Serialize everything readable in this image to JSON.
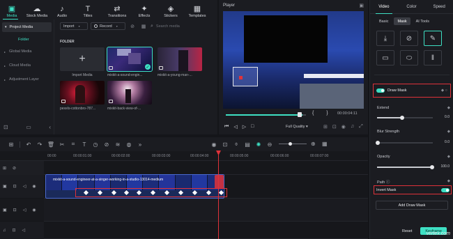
{
  "top_tools": [
    {
      "label": "Media",
      "icon": "▣",
      "active": true
    },
    {
      "label": "Stock Media",
      "icon": "☁"
    },
    {
      "label": "Audio",
      "icon": "♪"
    },
    {
      "label": "Titles",
      "icon": "T"
    },
    {
      "label": "Transitions",
      "icon": "⇄"
    },
    {
      "label": "Effects",
      "icon": "✦"
    },
    {
      "label": "Stickers",
      "icon": "◈"
    },
    {
      "label": "Templates",
      "icon": "▦"
    }
  ],
  "left_nav": {
    "project_media": "Project Media",
    "folder": "Folder",
    "items": [
      "Global Media",
      "Cloud Media",
      "Adjustment Layer"
    ]
  },
  "media_bar": {
    "import_label": "Import",
    "record_label": "Record",
    "search_placeholder": "Search media"
  },
  "folder_label": "FOLDER",
  "media_items": [
    {
      "caption": "Import Media"
    },
    {
      "caption": "mixkit-a-sound-engin..."
    },
    {
      "caption": "mixkit-a-young-man-..."
    },
    {
      "caption": "pexels-cottonbro-787..."
    },
    {
      "caption": "mixkit-back-view-of-..."
    }
  ],
  "player": {
    "title": "Player",
    "timecode": "00:00:04:11",
    "quality": "Full Quality",
    "brackets": "{ }"
  },
  "props": {
    "tabs": [
      "Video",
      "Color",
      "Speed"
    ],
    "subtabs": [
      "Basic",
      "Mask",
      "AI Tools"
    ],
    "draw_mask": "Draw Mask",
    "extend": "Extend",
    "extend_value": "0.0",
    "blur": "Blur Strength",
    "blur_value": "0.0",
    "opacity": "Opacity",
    "opacity_value": "100.0",
    "path": "Path",
    "invert_mask": "Invert Mask",
    "add_draw_mask": "Add Draw Mask",
    "reset": "Reset",
    "keyframe": "Keyframe"
  },
  "ruler_ticks": [
    "00:00",
    "00:00:01:00",
    "00:00:02:00",
    "00:00:03:00",
    "00:00:04:00",
    "00:00:05:00",
    "00:00:06:00",
    "00:00:07:00"
  ],
  "clip_title": "mixkit-a-sound-engineer-at-a-singer-working-in-a-studio-13014-medium",
  "watermark": "vertex.com"
}
